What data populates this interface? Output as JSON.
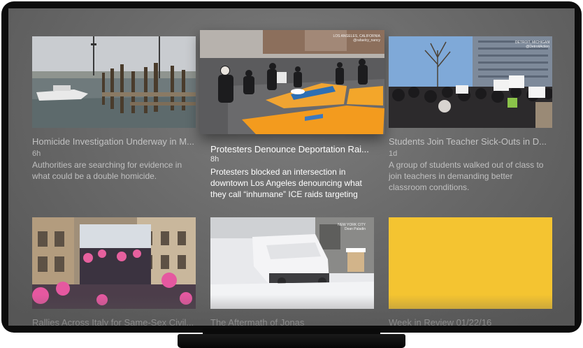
{
  "cards": [
    {
      "title": "Homicide Investigation Underway in M...",
      "age": "6h",
      "description": "Authorities are searching for evidence in what could be a double homicide."
    },
    {
      "title": "Protesters Denounce Deportation Rai...",
      "age": "8h",
      "description": "Protesters blocked an intersection in downtown Los Angeles denouncing what they call “inhumane” ICE raids targeting",
      "watermark_1": "LOS ANGELES, CALIFORNIA",
      "watermark_2": "@rafaelcy_nancy"
    },
    {
      "title": "Students Join Teacher Sick-Outs in D...",
      "age": "1d",
      "description": "A group of students walked out of class to join teachers in demanding better classroom conditions.",
      "watermark_1": "DETROIT, MICHIGAN",
      "watermark_2": "@DetroitAction"
    },
    {
      "title": "Rallies Across Italy for Same-Sex Civil...",
      "age": "",
      "description": ""
    },
    {
      "title": "The Aftermath of Jonas",
      "age": "",
      "description": "",
      "watermark_1": "NEW YORK CITY",
      "watermark_2": "Dean Paladin"
    },
    {
      "title": "Week in Review 01/22/16",
      "age": "",
      "description": "",
      "color": "#f4c431"
    }
  ]
}
